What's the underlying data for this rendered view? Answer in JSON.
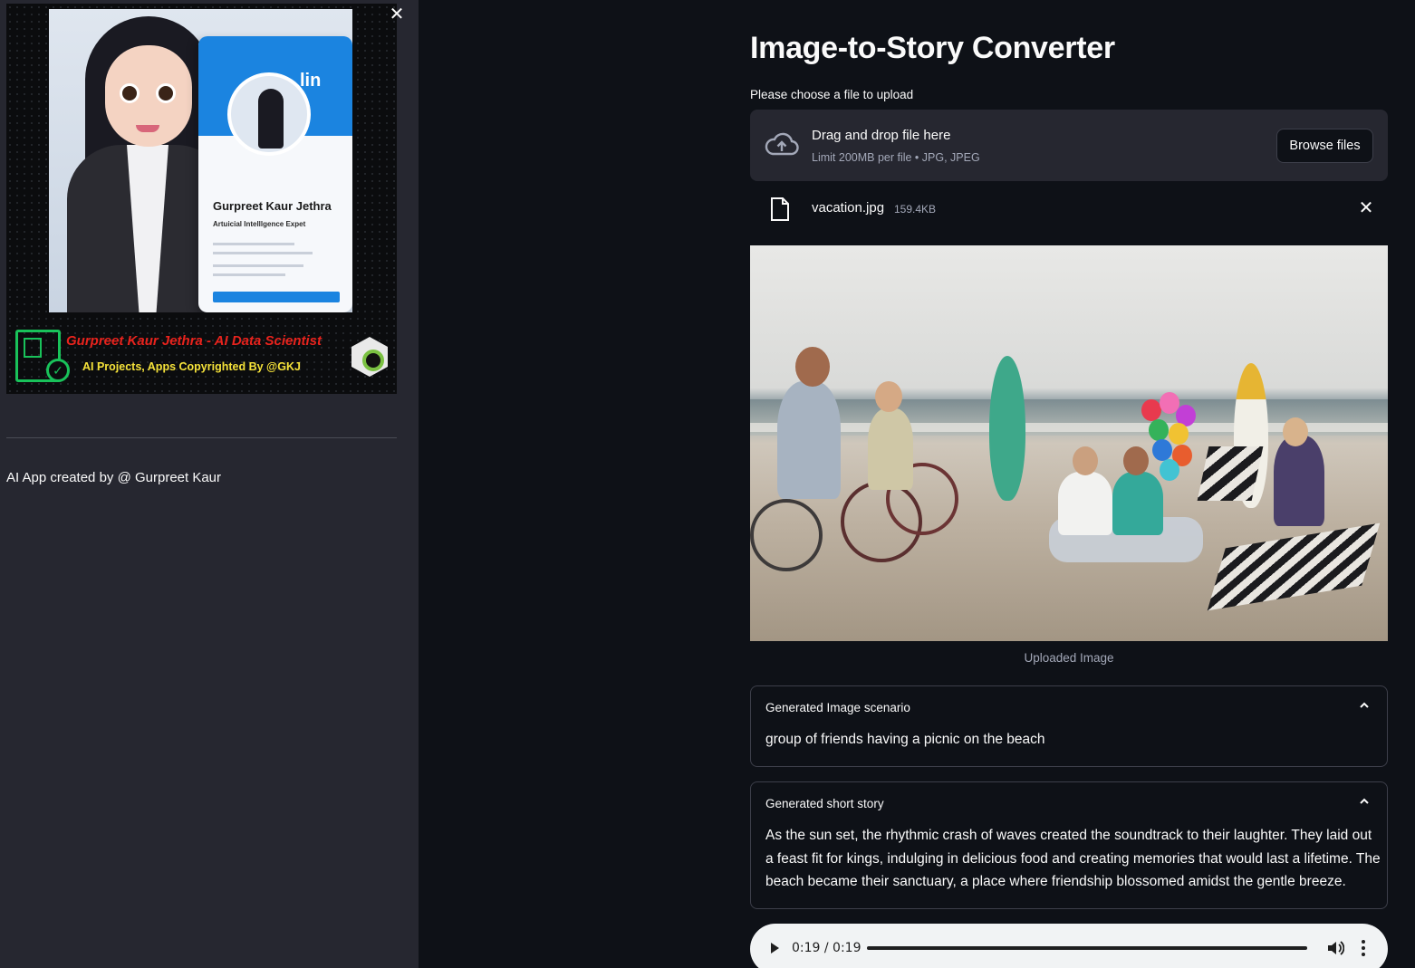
{
  "sidebar": {
    "close_icon": "close-icon",
    "banner": {
      "card_name": "Gurpreet Kaur Jethra",
      "card_role": "Artuicial Intelllgence Expet",
      "card_brand": "lin",
      "title": "Gurpreet Kaur Jethra - AI Data Scientist",
      "subtitle": "AI Projects, Apps Copyrighted By @GKJ"
    },
    "credit": "AI App created by @ Gurpreet Kaur"
  },
  "main": {
    "title": "Image-to-Story Converter",
    "uploader": {
      "label": "Please choose a file to upload",
      "drop_title": "Drag and drop file here",
      "limit": "Limit 200MB per file • JPG, JPEG",
      "browse_label": "Browse files",
      "icon": "cloud-upload-icon"
    },
    "file": {
      "name": "vacation.jpg",
      "size": "159.4KB",
      "icon": "file-icon"
    },
    "image_caption": "Uploaded Image",
    "scenario": {
      "header": "Generated Image scenario",
      "body": "group of friends having a picnic on the beach"
    },
    "story": {
      "header": "Generated short story",
      "body": "As the sun set, the rhythmic crash of waves created the soundtrack to their laughter. They laid out a feast fit for kings, indulging in delicious food and creating memories that would last a lifetime. The beach became their sanctuary, a place where friendship blossomed amidst the gentle breeze."
    },
    "audio": {
      "time": "0:19 / 0:19",
      "progress": 1.0
    }
  },
  "colors": {
    "background": "#0e1117",
    "sidebar": "#262730",
    "banner_title": "#e8231d",
    "banner_subtitle": "#f5e23a",
    "cert_green": "#19c25a"
  }
}
